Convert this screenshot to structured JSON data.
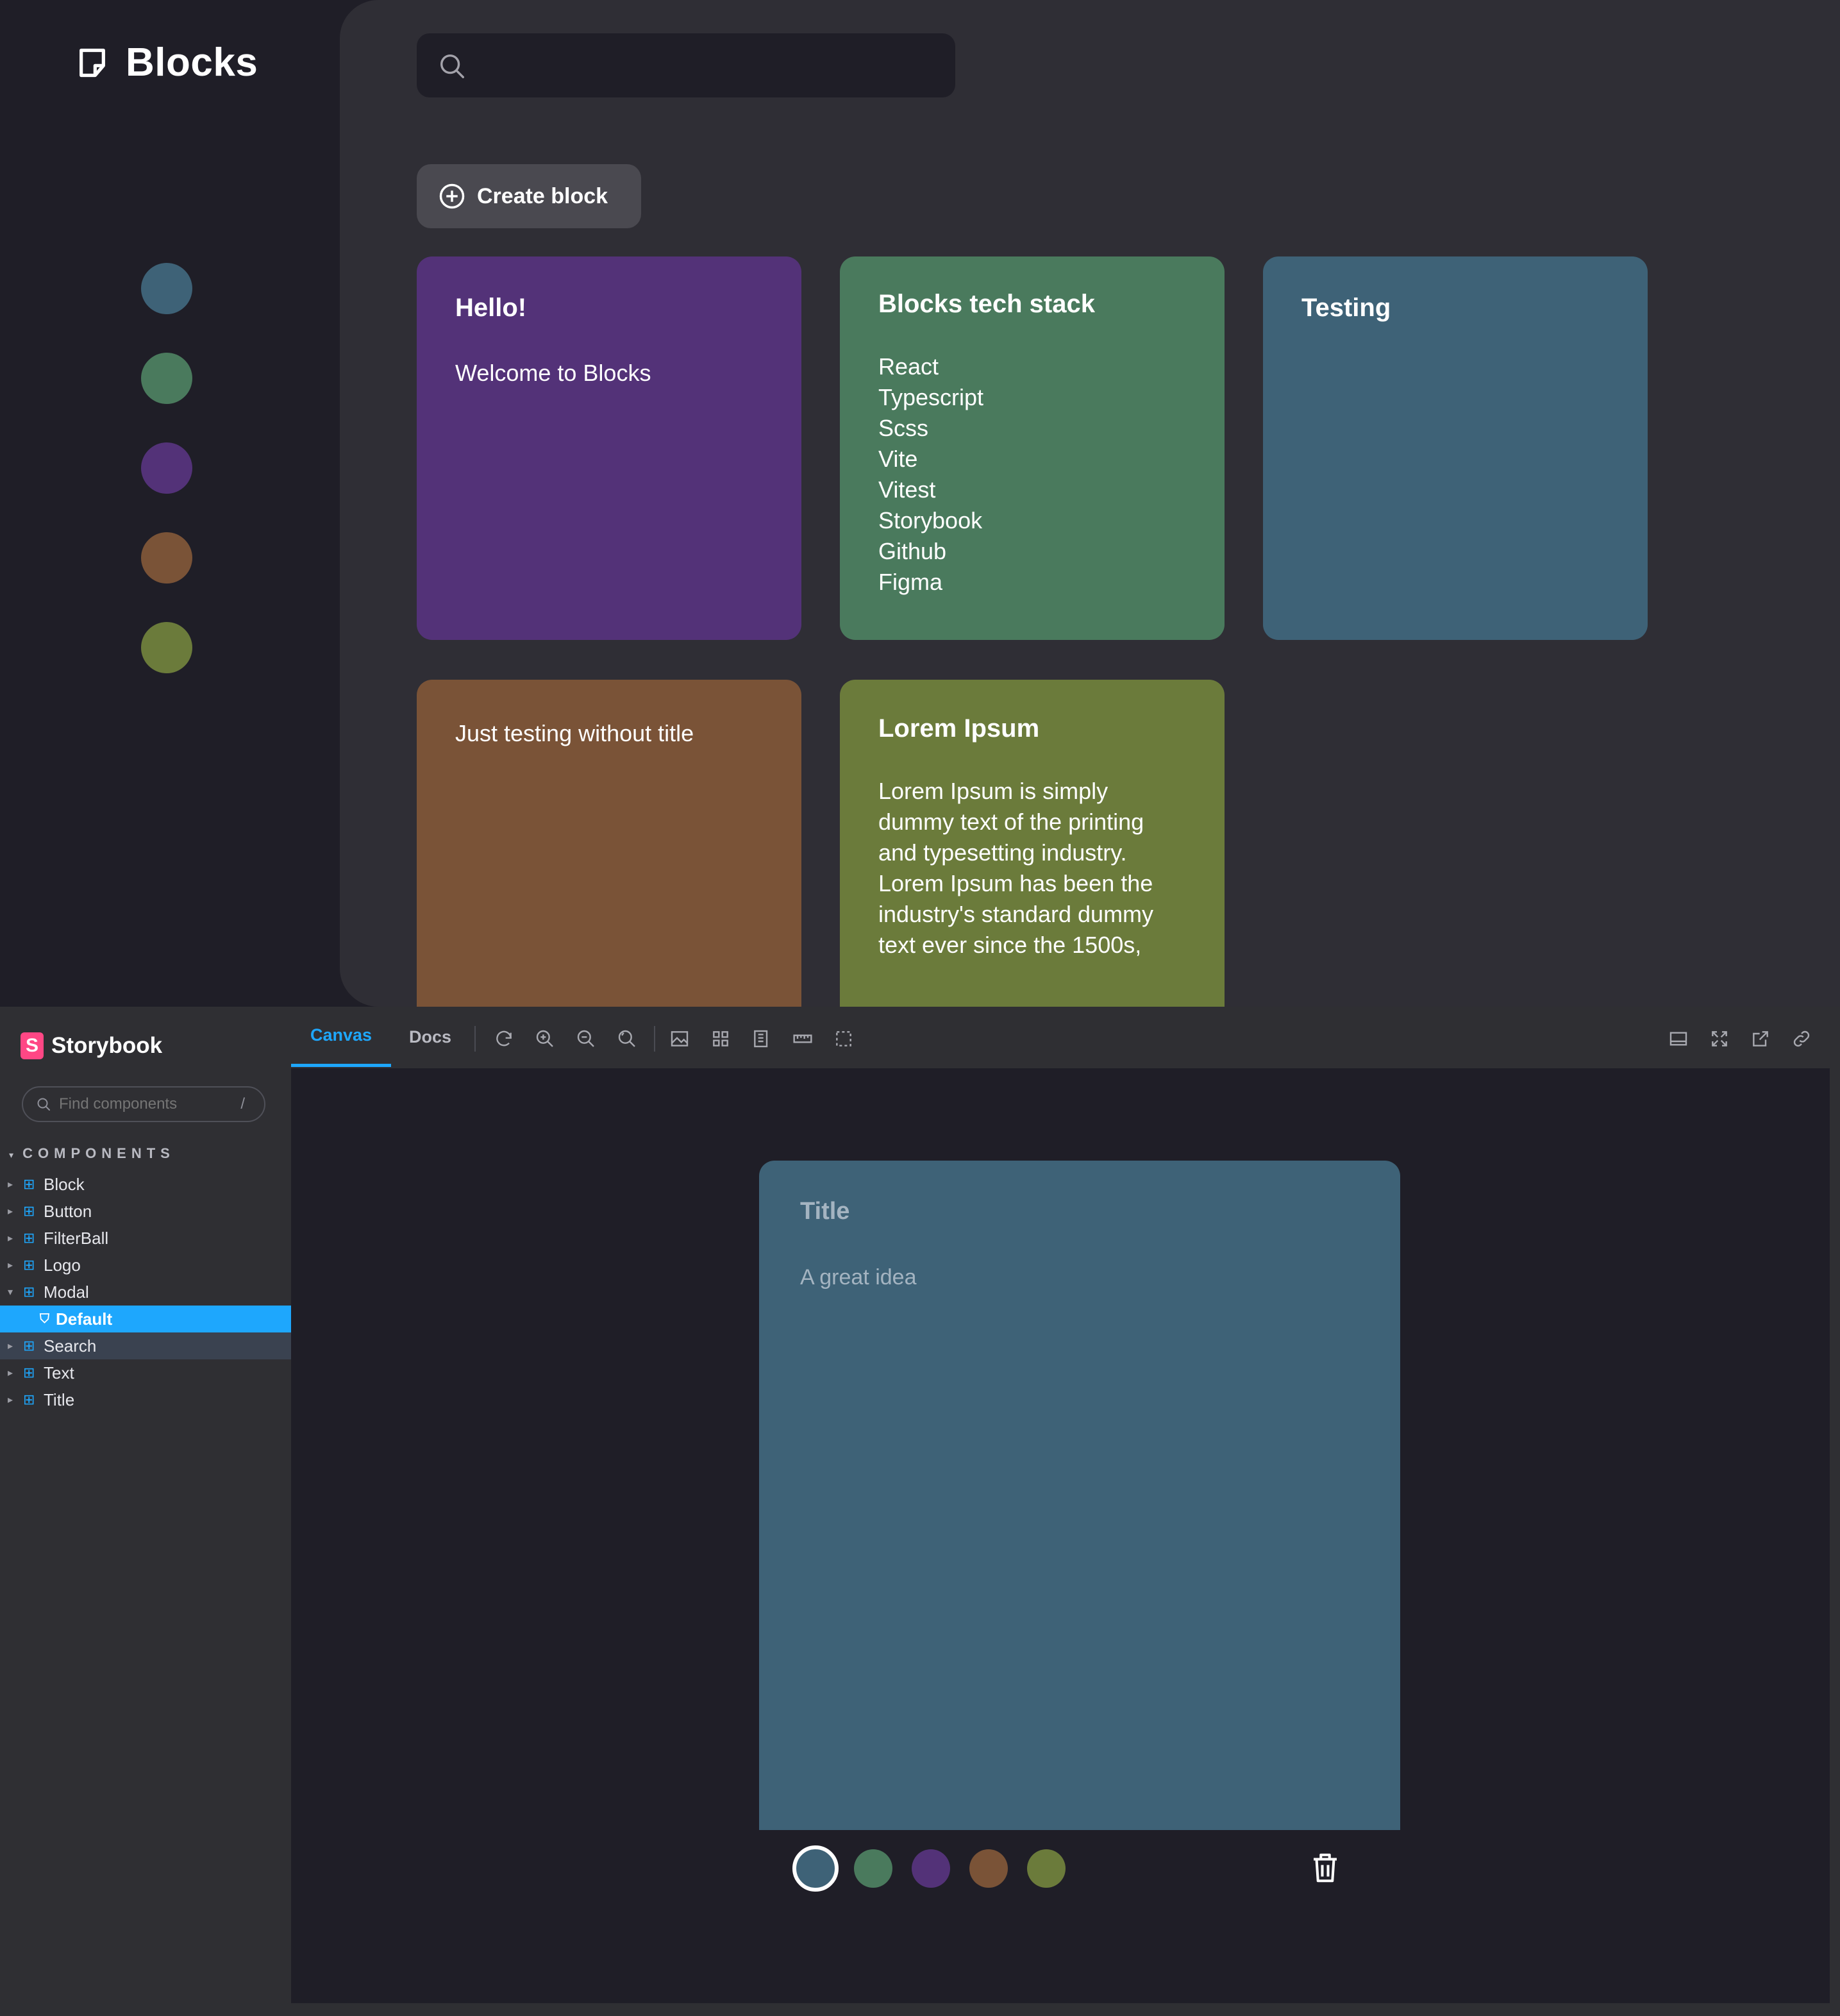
{
  "app": {
    "logo_text": "Blocks",
    "create_label": "Create block",
    "filter_colors": [
      "#3e6277",
      "#4a7a5d",
      "#533278",
      "#7a5337",
      "#6b7b3b"
    ],
    "blocks": [
      {
        "title": "Hello!",
        "text": "Welcome to Blocks",
        "color": "#533278"
      },
      {
        "title": "Blocks tech stack",
        "text": "React\nTypescript\nScss\nVite\nVitest\nStorybook\nGithub\nFigma",
        "color": "#4a7a5d"
      },
      {
        "title": "Testing",
        "text": "",
        "color": "#3e6277"
      },
      {
        "title": "",
        "text": "Just testing without title",
        "color": "#7a5337"
      },
      {
        "title": "Lorem Ipsum",
        "text": "Lorem Ipsum is simply\ndummy text of the printing\nand typesetting industry.\nLorem Ipsum has been the\nindustry's standard dummy\ntext ever since the 1500s,",
        "color": "#6b7b3b"
      }
    ]
  },
  "storybook": {
    "brand": "Storybook",
    "brand_icon": "S",
    "search_placeholder": "Find components",
    "search_shortcut": "/",
    "section": "COMPONENTS",
    "items": [
      "Block",
      "Button",
      "FilterBall",
      "Logo",
      "Modal",
      "Default",
      "Search",
      "Text",
      "Title"
    ],
    "tabs": [
      "Canvas",
      "Docs"
    ],
    "modal": {
      "title": "Title",
      "text": "A great idea",
      "color": "#3e6277"
    },
    "modal_colors": [
      "#3e6277",
      "#4a7a5d",
      "#533278",
      "#7a5337",
      "#6b7b3b"
    ],
    "accent": "#1ea7fd"
  }
}
